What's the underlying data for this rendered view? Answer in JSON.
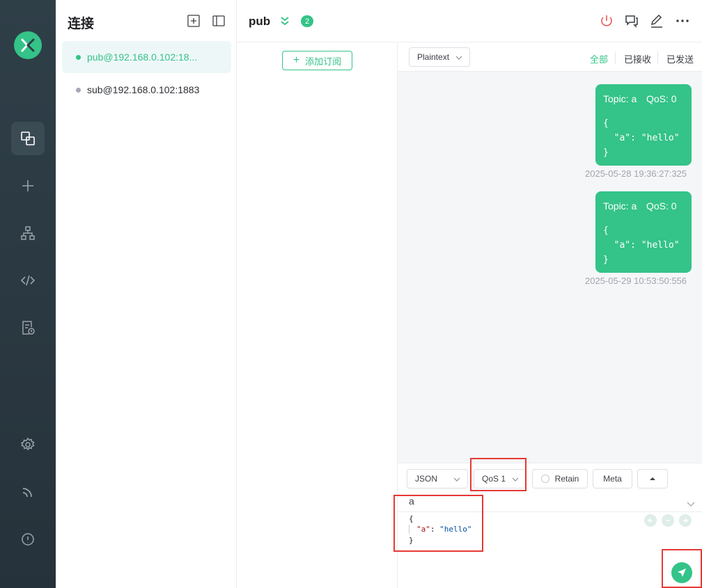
{
  "sidebar": {
    "title": "连接",
    "connections": [
      {
        "label": "pub@192.168.0.102:18...",
        "status_color": "#34c388",
        "active": true
      },
      {
        "label": "sub@192.168.0.102:1883",
        "status_color": "#a5a9b3",
        "active": false
      }
    ]
  },
  "header": {
    "name": "pub",
    "badge": "2"
  },
  "subscriptions": {
    "add_label": "添加订阅"
  },
  "messages": {
    "format": "Plaintext",
    "filters": [
      "全部",
      "已接收",
      "已发送"
    ],
    "active_filter": "全部",
    "items": [
      {
        "topic": "Topic: a",
        "qos": "QoS: 0",
        "payload": "{\n  \"a\": \"hello\"\n}",
        "time": "2025-05-28 19:36:27:325"
      },
      {
        "topic": "Topic: a",
        "qos": "QoS: 0",
        "payload": "{\n  \"a\": \"hello\"\n}",
        "time": "2025-05-29 10:53:50:556"
      }
    ]
  },
  "publish": {
    "format": "JSON",
    "qos": "QoS 1",
    "retain_label": "Retain",
    "meta_label": "Meta",
    "topic": "a",
    "payload_open": "{",
    "payload_key": "\"a\"",
    "payload_colon": ": ",
    "payload_value": "\"hello\"",
    "payload_close": "}"
  },
  "colors": {
    "accent": "#34c388",
    "rail": "#2f3f48",
    "highlight": "#e53935"
  }
}
